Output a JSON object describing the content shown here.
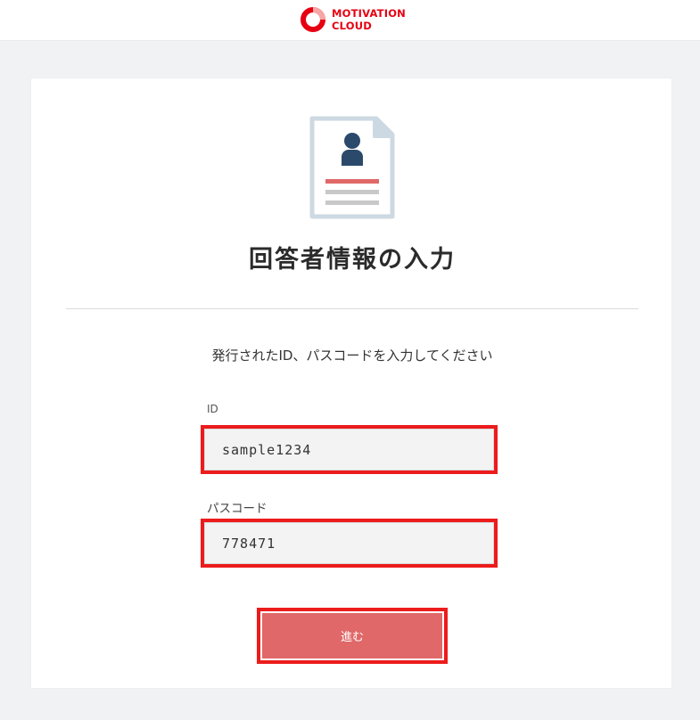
{
  "header": {
    "logo_line1": "MOTIVATION",
    "logo_line2": "CLOUD",
    "brand_color": "#e60012"
  },
  "card": {
    "icon": "document-person-icon",
    "title": "回答者情報の入力",
    "instruction": "発行されたID、パスコードを入力してください",
    "id_field": {
      "label": "ID",
      "value": "sample1234"
    },
    "passcode_field": {
      "label": "パスコード",
      "value": "778471"
    },
    "submit_button": {
      "label": "進む",
      "color": "#e06868"
    }
  }
}
